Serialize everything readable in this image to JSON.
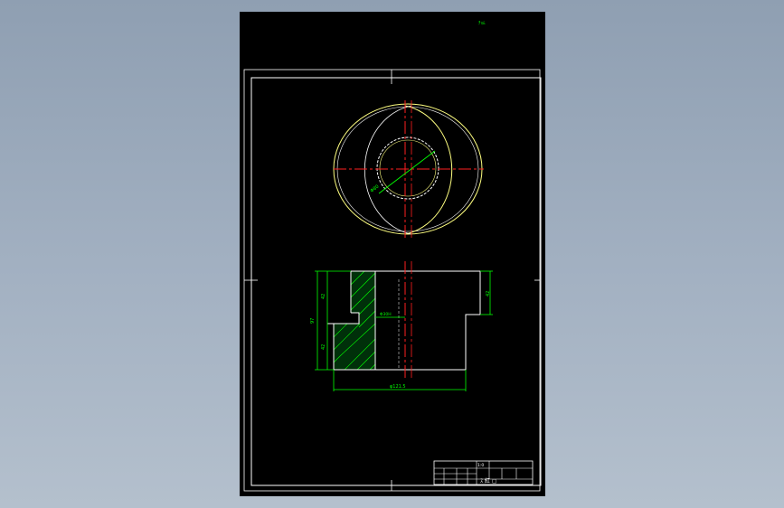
{
  "viewport": {
    "background": "#9aa8ba",
    "sheet_background": "#000000"
  },
  "colors": {
    "frame": "#ffffff",
    "outline_yellow": "#ffff80",
    "outline_white": "#ffffff",
    "centerline": "#ff2020",
    "dimension": "#00ff00",
    "hatch": "#00ff00"
  },
  "drawing": {
    "corner_note": "ﾁｮﾑ",
    "top_view": {
      "diameter_label": "Φ80"
    },
    "section_view": {
      "left_height_label": "97",
      "upper_step_label": "42",
      "lower_step_label": "42",
      "right_height_label": "42",
      "bore_label": "Φ30H",
      "bottom_diameter_label": "φ121.5"
    },
    "title_block": {
      "scale_cell": "1:0",
      "part_name": "ｽ  紅 ▢"
    }
  }
}
